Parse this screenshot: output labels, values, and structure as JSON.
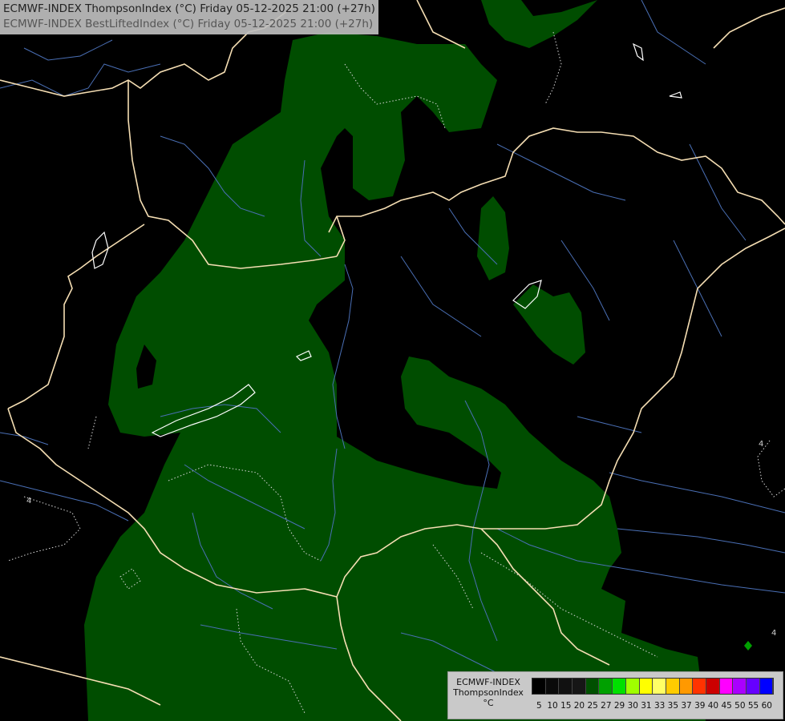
{
  "title": {
    "line1": "ECMWF-INDEX ThompsonIndex (°C) Friday 05-12-2025 21:00 (+27h)",
    "line2": "ECMWF-INDEX BestLiftedIndex (°C) Friday 05-12-2025 21:00 (+27h)"
  },
  "map_labels": {
    "contour_left": "4",
    "contour_right_top": "4",
    "contour_right_bottom": "4"
  },
  "legend": {
    "line1": "ECMWF-INDEX",
    "line2": "ThompsonIndex",
    "line3": "°C",
    "ticks": [
      "5",
      "10",
      "15",
      "20",
      "25",
      "27",
      "29",
      "30",
      "31",
      "33",
      "35",
      "37",
      "39",
      "40",
      "45",
      "50",
      "55",
      "60"
    ],
    "colors": [
      "#000000",
      "#0a0a0a",
      "#111111",
      "#161616",
      "#005000",
      "#00a000",
      "#00e000",
      "#a0ff00",
      "#ffff00",
      "#ffff66",
      "#ffcc00",
      "#ff9900",
      "#ff3300",
      "#cc0000",
      "#ff00ff",
      "#aa00ff",
      "#6600ff",
      "#0000ff"
    ]
  },
  "colors": {
    "background": "#000000",
    "fill_green": "#004d00",
    "border": "#f5deb3",
    "river": "#4a6fb5",
    "contour": "#d8d8d8"
  }
}
